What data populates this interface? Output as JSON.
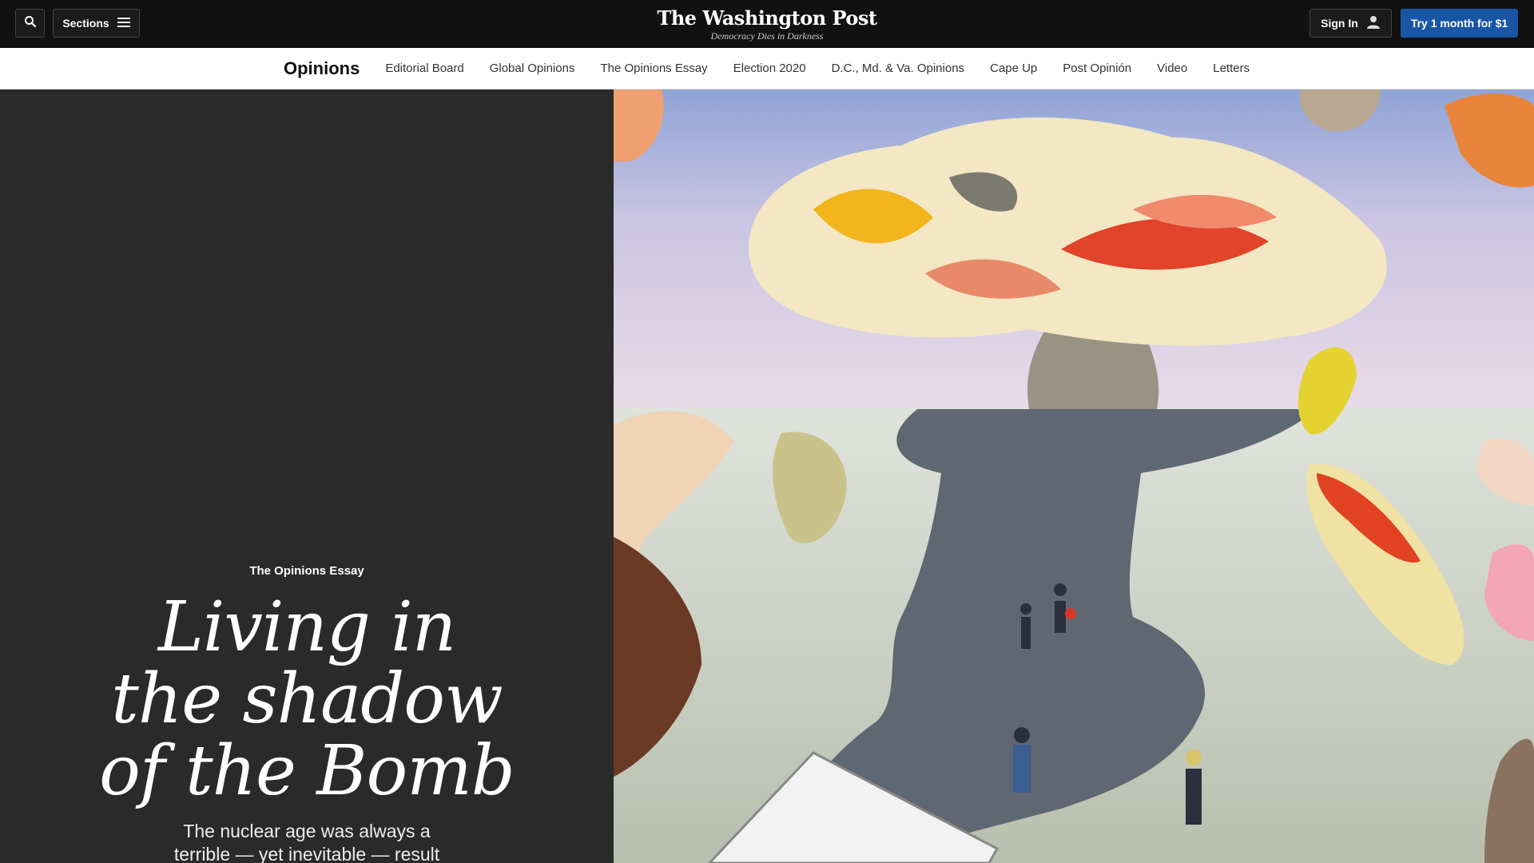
{
  "header": {
    "sections_label": "Sections",
    "logo_text": "The Washington Post",
    "tagline": "Democracy Dies in Darkness",
    "signin_label": "Sign In",
    "try_label": "Try 1 month for $1"
  },
  "subnav": {
    "title": "Opinions",
    "items": [
      "Editorial Board",
      "Global Opinions",
      "The Opinions Essay",
      "Election 2020",
      "D.C., Md. & Va. Opinions",
      "Cape Up",
      "Post Opinión",
      "Video",
      "Letters"
    ]
  },
  "article": {
    "kicker": "The Opinions Essay",
    "headline_line1": "Living in",
    "headline_line2": "the shadow",
    "headline_line3": "of the Bomb",
    "dek_line1": "The nuclear age was always a",
    "dek_line2": "terrible — yet inevitable — result"
  },
  "colors": {
    "topbar": "#111111",
    "accent_button": "#1955a5",
    "left_panel": "#2a2a2a"
  }
}
